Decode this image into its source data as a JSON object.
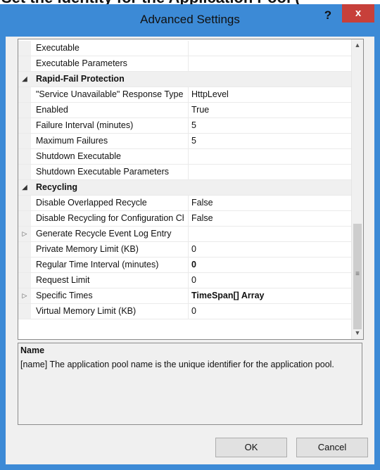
{
  "top_cut_text": "Set the identity for the Application Pool (",
  "window": {
    "title": "Advanced Settings",
    "help_label": "?",
    "close_label": "x"
  },
  "grid": {
    "rows": [
      {
        "type": "property",
        "label": "Executable",
        "value": ""
      },
      {
        "type": "property",
        "label": "Executable Parameters",
        "value": ""
      },
      {
        "type": "category",
        "label": "Rapid-Fail Protection",
        "expander": "◢"
      },
      {
        "type": "property",
        "label": "\"Service Unavailable\" Response Type",
        "value": "HttpLevel"
      },
      {
        "type": "property",
        "label": "Enabled",
        "value": "True"
      },
      {
        "type": "property",
        "label": "Failure Interval (minutes)",
        "value": "5"
      },
      {
        "type": "property",
        "label": "Maximum Failures",
        "value": "5"
      },
      {
        "type": "property",
        "label": "Shutdown Executable",
        "value": ""
      },
      {
        "type": "property",
        "label": "Shutdown Executable Parameters",
        "value": ""
      },
      {
        "type": "category",
        "label": "Recycling",
        "expander": "◢"
      },
      {
        "type": "property",
        "label": "Disable Overlapped Recycle",
        "value": "False"
      },
      {
        "type": "property",
        "label": "Disable Recycling for Configuration Changes",
        "value": "False"
      },
      {
        "type": "expandable",
        "label": "Generate Recycle Event Log Entry",
        "value": "",
        "expander": "▷"
      },
      {
        "type": "property",
        "label": "Private Memory Limit (KB)",
        "value": "0"
      },
      {
        "type": "property",
        "label": "Regular Time Interval (minutes)",
        "value": "0",
        "bold_value": true
      },
      {
        "type": "property",
        "label": "Request Limit",
        "value": "0"
      },
      {
        "type": "expandable",
        "label": "Specific Times",
        "value": "TimeSpan[] Array",
        "bold_value": true,
        "expander": "▷"
      },
      {
        "type": "property",
        "label": "Virtual Memory Limit (KB)",
        "value": "0"
      }
    ],
    "scroll_up_icon": "▲",
    "scroll_down_icon": "▼",
    "thumb_grip": "≡"
  },
  "description": {
    "title": "Name",
    "text": "[name] The application pool name is the unique identifier for the application pool."
  },
  "buttons": {
    "ok_label": "OK",
    "cancel_label": "Cancel"
  }
}
